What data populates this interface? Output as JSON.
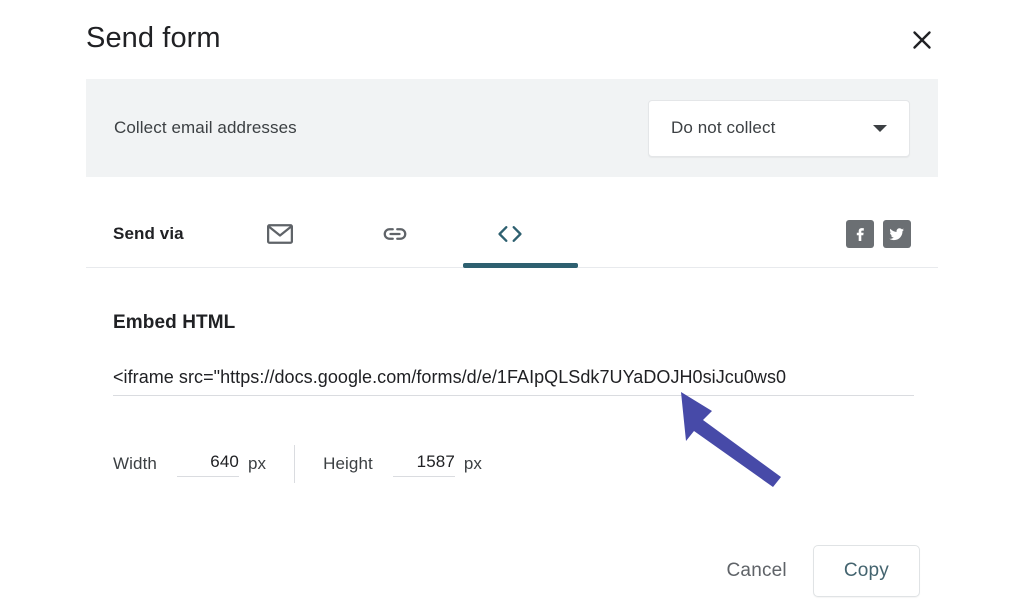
{
  "dialog": {
    "title": "Send form",
    "close_icon": "close-icon"
  },
  "collect_email": {
    "label": "Collect email addresses",
    "selected_option": "Do not collect",
    "caret_icon": "chevron-down-icon"
  },
  "send_via": {
    "label": "Send via",
    "tabs": [
      {
        "name": "email",
        "icon": "envelope-icon",
        "active": false
      },
      {
        "name": "link",
        "icon": "link-icon",
        "active": false
      },
      {
        "name": "embed",
        "icon": "code-brackets-icon",
        "active": true
      }
    ],
    "social": [
      {
        "name": "facebook",
        "icon": "facebook-icon"
      },
      {
        "name": "twitter",
        "icon": "twitter-icon"
      }
    ]
  },
  "embed": {
    "section_title": "Embed HTML",
    "value": "<iframe src=\"https://docs.google.com/forms/d/e/1FAIpQLSdk7UYaDOJH0siJcu0ws0",
    "width_label": "Width",
    "width_value": "640",
    "width_unit": "px",
    "height_label": "Height",
    "height_value": "1587",
    "height_unit": "px"
  },
  "footer": {
    "cancel_label": "Cancel",
    "copy_label": "Copy"
  },
  "colors": {
    "band_background": "#f1f3f4",
    "active_tab_indicator": "#2e6070",
    "copy_text": "#44646f",
    "social_chip": "#6b6f73",
    "annotation_arrow": "#474aa8"
  }
}
